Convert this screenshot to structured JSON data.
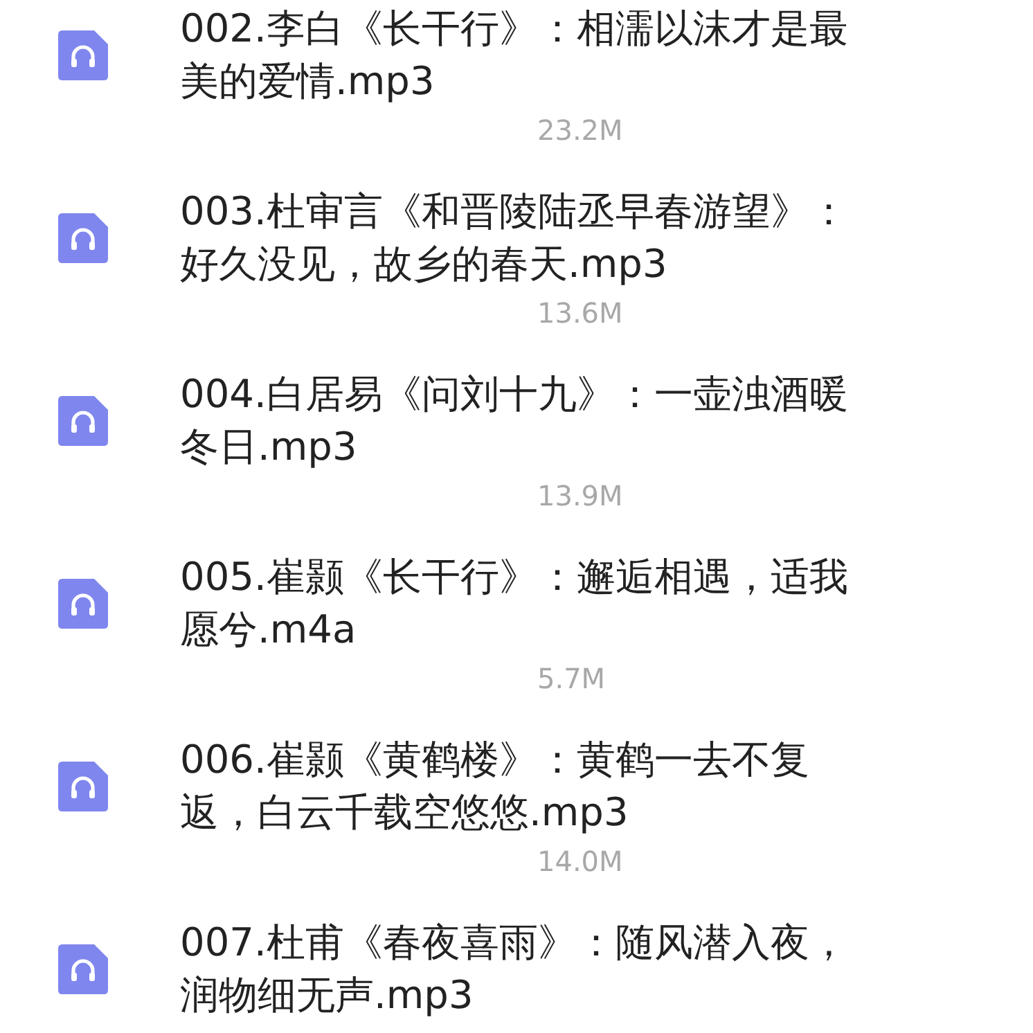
{
  "files": [
    {
      "name": "002.李白《长干行》：相濡以沫才是最美的爱情.mp3",
      "size": "23.2M"
    },
    {
      "name": "003.杜审言《和晋陵陆丞早春游望》：好久没见，故乡的春天.mp3",
      "size": "13.6M"
    },
    {
      "name": "004.白居易《问刘十九》：一壶浊酒暖冬日.mp3",
      "size": "13.9M"
    },
    {
      "name": "005.崔颢《长干行》：邂逅相遇，适我愿兮.m4a",
      "size": "5.7M"
    },
    {
      "name": "006.崔颢《黄鹤楼》：黄鹤一去不复返，白云千载空悠悠.mp3",
      "size": "14.0M"
    },
    {
      "name": "007.杜甫《春夜喜雨》：随风潜入夜，润物细无声.mp3"
    }
  ]
}
